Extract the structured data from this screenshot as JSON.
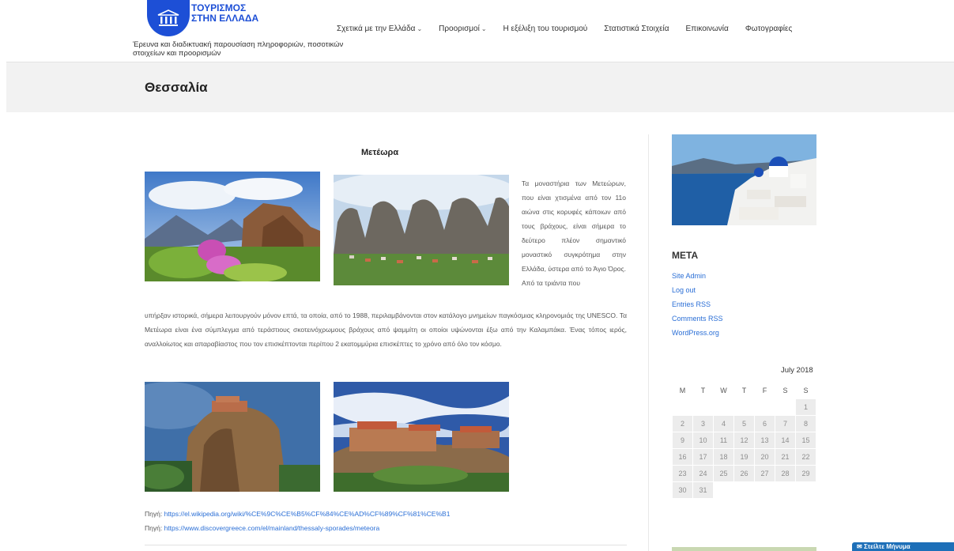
{
  "site": {
    "logo_line1": "ΤΟΥΡΙΣΜΟΣ",
    "logo_line2": "ΣΤΗΝ ΕΛΛΑΔΑ",
    "tagline": "Έρευνα και διαδικτυακή παρουσίαση πληροφοριών, ποσοτικών στοιχείων και προορισμών"
  },
  "nav": {
    "items": [
      {
        "label": "Σχετικά με την Ελλάδα",
        "dropdown": true
      },
      {
        "label": "Προορισμοί",
        "dropdown": true
      },
      {
        "label": "Η εξέλιξη του τουρισμού",
        "dropdown": false
      },
      {
        "label": "Στατιστικά Στοιχεία",
        "dropdown": false
      },
      {
        "label": "Επικοινωνία",
        "dropdown": false
      },
      {
        "label": "Φωτογραφίες",
        "dropdown": false
      }
    ]
  },
  "page": {
    "title": "Θεσσαλία",
    "article_heading": "Μετέωρα",
    "paragraph_part1": "Τα μοναστήρια των Μετεώρων, που είναι χτισμένα από τον 11ο αιώνα στις κορυφές κάποιων από τους βράχους, είναι σήμερα το δεύτερο πλέον σημαντικό μοναστικό συγκρότημα στην Ελλάδα, ύστερα από το Άγιο Όρος. Από τα τριάντα που",
    "paragraph_part2": "υπήρξαν ιστορικά, σήμερα λειτουργούν μόνον επτά, τα οποία, από το 1988, περιλαμβάνονται στον κατάλογο μνημείων παγκόσμιας κληρονομιάς της UNESCO. Τα Μετέωρα είναι ένα σύμπλεγμα από τεράστιους σκοτεινόχρωμους βράχους από ψαμμίτη οι οποίοι υψώνονται έξω από την Καλαμπάκα. Ένας τόπος ιερός, αναλλοίωτος και απαραβίαστος που τον επισκέπτονται περίπου 2 εκατομμύρια επισκέπτες το χρόνο από όλο τον κόσμο.",
    "sources": [
      {
        "prefix": "Πηγή: ",
        "link": "https://el.wikipedia.org/wiki/%CE%9C%CE%B5%CF%84%CE%AD%CF%89%CF%81%CE%B1"
      },
      {
        "prefix": "Πηγή: ",
        "link": "https://www.discovergreece.com/el/mainland/thessaly-sporades/meteora"
      }
    ]
  },
  "sidebar": {
    "meta_title": "META",
    "meta_links": [
      "Site Admin",
      "Log out",
      "Entries RSS",
      "Comments RSS",
      "WordPress.org"
    ],
    "calendar": {
      "caption": "July 2018",
      "weekdays": [
        "M",
        "T",
        "W",
        "T",
        "F",
        "S",
        "S"
      ],
      "weeks": [
        [
          "",
          "",
          "",
          "",
          "",
          "",
          "1"
        ],
        [
          "2",
          "3",
          "4",
          "5",
          "6",
          "7",
          "8"
        ],
        [
          "9",
          "10",
          "11",
          "12",
          "13",
          "14",
          "15"
        ],
        [
          "16",
          "17",
          "18",
          "19",
          "20",
          "21",
          "22"
        ],
        [
          "23",
          "24",
          "25",
          "26",
          "27",
          "28",
          "29"
        ],
        [
          "30",
          "31",
          "",
          "",
          "",
          "",
          ""
        ]
      ]
    }
  },
  "contact_widget": {
    "label": "Στείλτε Μήνυμα"
  },
  "colors": {
    "brand": "#1d4fd6",
    "link": "#2b6fd6",
    "band": "#f2f2f2"
  }
}
